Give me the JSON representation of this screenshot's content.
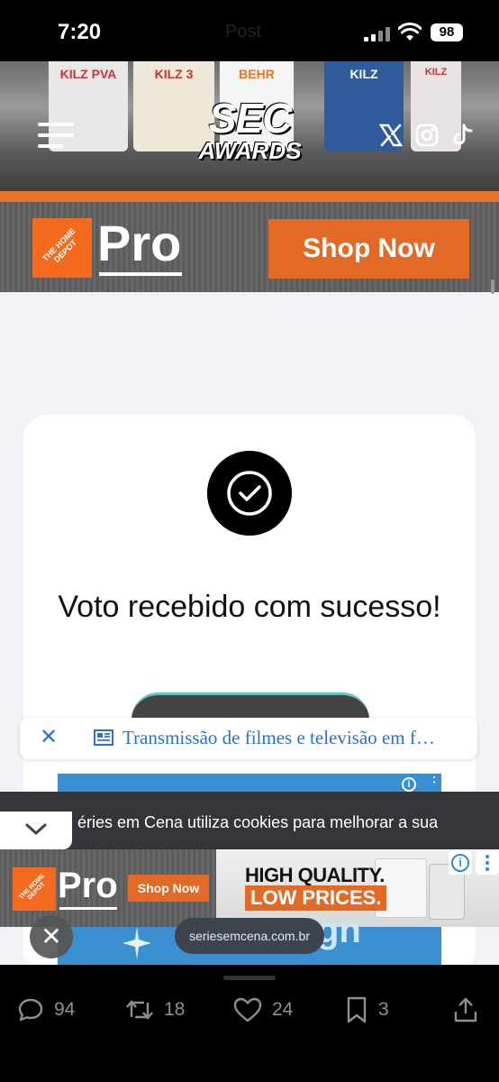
{
  "status_bar": {
    "time": "7:20",
    "ghost_title": "Post",
    "battery": "98"
  },
  "header": {
    "logo_top": "SEC",
    "logo_bottom": "AWARDS",
    "social_icons": [
      "x-icon",
      "instagram-icon",
      "tiktok-icon"
    ],
    "background_cans": [
      "KILZ PVA",
      "KILZ 3",
      "BEHR",
      "KILZ",
      "KILZ"
    ]
  },
  "top_ad": {
    "brand_logo": "THE HOME DEPOT",
    "pro_label": "Pro",
    "cta": "Shop Now"
  },
  "card": {
    "message": "Voto recebido com sucesso!"
  },
  "link_bar": {
    "text": "Transmissão de filmes e televisão em f…"
  },
  "cookie_banner": {
    "text": "éries em Cena utiliza cookies para melhorar a sua"
  },
  "bottom_ad": {
    "brand_logo": "THE HOME DEPOT",
    "pro_label": "Pro",
    "cta": "Shop Now",
    "headline": "HIGH QUALITY.",
    "subheadline": "LOW PRICES.",
    "partial_text": "gn"
  },
  "browser": {
    "url": "seriesemcena.com.br"
  },
  "actions": {
    "replies": "94",
    "reposts": "18",
    "likes": "24",
    "bookmarks": "3"
  },
  "colors": {
    "accent_orange": "#e26a26",
    "link_blue": "#2b6fd6",
    "page_bg": "#f2f2f6"
  }
}
